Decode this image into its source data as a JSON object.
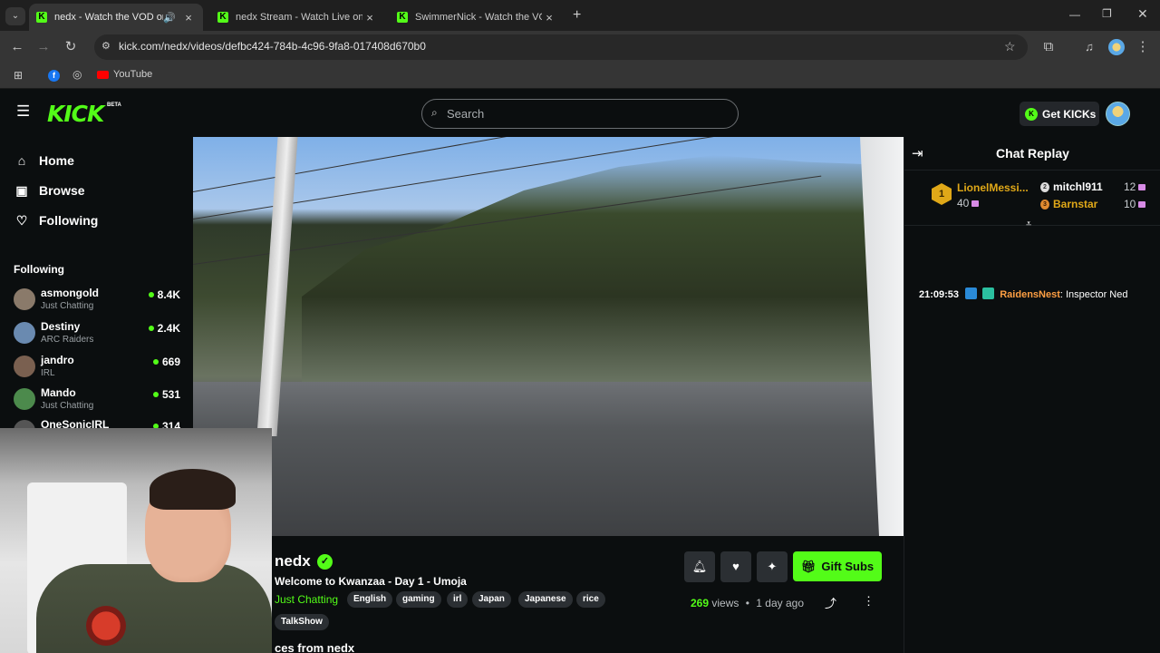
{
  "browser": {
    "tabs": [
      {
        "title": "nedx - Watch the VOD on K",
        "active": true,
        "audio": true
      },
      {
        "title": "nedx Stream - Watch Live on Ki",
        "active": false
      },
      {
        "title": "SwimmerNick - Watch the VOD",
        "active": false
      }
    ],
    "new_tab": "+",
    "url": "kick.com/nedx/videos/defbc424-784b-4c96-9fa8-017408d670b0",
    "bookmarks": [
      {
        "label": "YouTube"
      }
    ]
  },
  "header": {
    "logo": "KICK",
    "logo_badge": "BETA",
    "search_placeholder": "Search",
    "get_kicks_label": "Get KICKs"
  },
  "sidebar": {
    "nav": [
      {
        "label": "Home",
        "icon": "home-icon"
      },
      {
        "label": "Browse",
        "icon": "browse-icon"
      },
      {
        "label": "Following",
        "icon": "heart-icon"
      }
    ],
    "following_title": "Following",
    "following": [
      {
        "name": "asmongold",
        "category": "Just Chatting",
        "viewers": "8.4K",
        "color": "#8a7a6a"
      },
      {
        "name": "Destiny",
        "category": "ARC Raiders",
        "viewers": "2.4K",
        "color": "#6a8ab0"
      },
      {
        "name": "jandro",
        "category": "IRL",
        "viewers": "669",
        "color": "#7a6050"
      },
      {
        "name": "Mando",
        "category": "Just Chatting",
        "viewers": "531",
        "color": "#4c8a4c"
      },
      {
        "name": "OneSonicIRL",
        "category": "",
        "viewers": "314",
        "color": "#555"
      }
    ]
  },
  "video": {
    "channel": "nedx",
    "title": "Welcome to Kwanzaa - Day 1 - Umoja",
    "category": "Just Chatting",
    "tags": [
      "English",
      "gaming",
      "irl",
      "Japan",
      "Japanese",
      "rice",
      "TalkShow"
    ],
    "views": "269",
    "views_label": "views",
    "separator": "•",
    "date": "1 day ago",
    "gift_subs_label": "Gift Subs",
    "more_heading": "ces from nedx"
  },
  "chat": {
    "title": "Chat Replay",
    "leaderboard": [
      {
        "rank": "1",
        "name": "LionelMessi...",
        "count": "40",
        "color": "#e0a818"
      },
      {
        "rank": "2",
        "name": "mitchl911",
        "count": "12",
        "color": "#ffffff"
      },
      {
        "rank": "3",
        "name": "Barnstar",
        "count": "10",
        "color": "#e0a818"
      }
    ],
    "messages": [
      {
        "time": "21:09:53",
        "user": "RaidensNest",
        "text": ": Inspector Ned"
      }
    ]
  },
  "colors": {
    "accent": "#53fc18",
    "background": "#0b0e0f"
  }
}
